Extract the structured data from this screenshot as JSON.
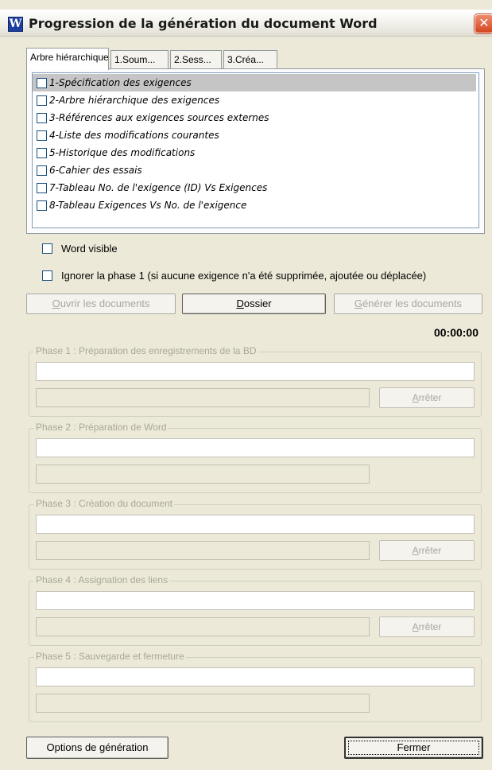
{
  "window": {
    "title": "Progression de la génération du document Word",
    "icon_letter": "W",
    "close_glyph": "✕"
  },
  "tabs": [
    {
      "label": "Arbre hiérarchique",
      "active": true
    },
    {
      "label": "1.Soum...",
      "active": false
    },
    {
      "label": "2.Sess...",
      "active": false
    },
    {
      "label": "3.Créa...",
      "active": false
    }
  ],
  "tree": {
    "items": [
      {
        "label": "1-Spécification des exigences",
        "selected": true,
        "checked": false
      },
      {
        "label": "2-Arbre hiérarchique des exigences",
        "selected": false,
        "checked": false
      },
      {
        "label": "3-Références aux exigences sources externes",
        "selected": false,
        "checked": false
      },
      {
        "label": "4-Liste des modifications courantes",
        "selected": false,
        "checked": false
      },
      {
        "label": "5-Historique des modifications",
        "selected": false,
        "checked": false
      },
      {
        "label": "6-Cahier des essais",
        "selected": false,
        "checked": false
      },
      {
        "label": "7-Tableau No. de l'exigence (ID) Vs Exigences",
        "selected": false,
        "checked": false
      },
      {
        "label": "8-Tableau Exigences Vs No. de l'exigence",
        "selected": false,
        "checked": false
      }
    ]
  },
  "options": {
    "word_visible": {
      "label": "Word visible",
      "checked": false
    },
    "ignore_phase1": {
      "label": "Ignorer la phase 1 (si aucune exigence n'a été supprimée, ajoutée ou déplacée)",
      "checked": false
    }
  },
  "actions": {
    "open_docs": {
      "mnemonic": "O",
      "rest": "uvrir les documents"
    },
    "folder": {
      "mnemonic": "D",
      "rest": "ossier"
    },
    "generate_docs": {
      "mnemonic": "G",
      "rest": "énérer les documents"
    }
  },
  "timer": "00:00:00",
  "phases": [
    {
      "legend": "Phase 1 : Préparation des enregistrements de la BD",
      "stop": {
        "mnemonic": "A",
        "rest": "rrêter"
      }
    },
    {
      "legend": "Phase 2 : Préparation de Word"
    },
    {
      "legend": "Phase 3 : Création du document",
      "stop": {
        "mnemonic": "A",
        "rest": "rrêter"
      }
    },
    {
      "legend": "Phase 4 : Assignation des liens",
      "stop": {
        "mnemonic": "A",
        "rest": "rrêter"
      }
    },
    {
      "legend": "Phase 5 : Sauvegarde et fermeture"
    }
  ],
  "footer": {
    "options_label": "Options de génération",
    "close_label": "Fermer"
  },
  "colors": {
    "window_bg": "#ece9d8",
    "selection": "#c5c5c5",
    "disabled_text": "#a9a79a",
    "close_button": "#d3451f"
  }
}
